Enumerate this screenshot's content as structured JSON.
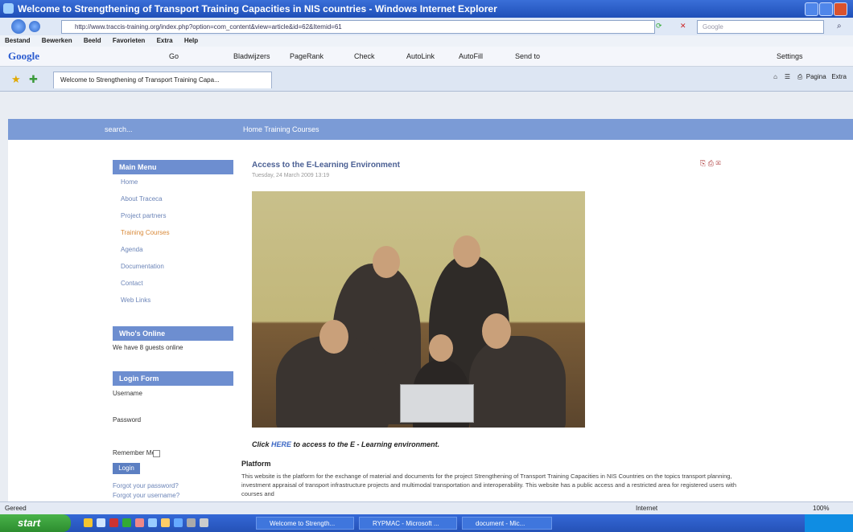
{
  "window": {
    "title": "Welcome to Strengthening of Transport Training Capacities in NIS countries - Windows Internet Explorer"
  },
  "address": {
    "url": "http://www.traccis-training.org/index.php?option=com_content&view=article&id=62&Itemid=61",
    "search_placeholder": "Google"
  },
  "menubar": {
    "items": [
      "Bestand",
      "Bewerken",
      "Beeld",
      "Favorieten",
      "Extra",
      "Help"
    ]
  },
  "google_toolbar": {
    "logo": "Google",
    "items": [
      "Go",
      "Bladwijzers",
      "PageRank",
      "Check",
      "AutoLink",
      "AutoFill",
      "Send to"
    ],
    "settings": "Settings"
  },
  "tabs": {
    "active_tab": "Welcome to Strengthening of Transport Training Capa..."
  },
  "commandbar": {
    "page": "Pagina",
    "extra": "Extra"
  },
  "site": {
    "search_label": "search...",
    "breadcrumb": "Home   Training Courses",
    "main_menu": {
      "header": "Main Menu",
      "items": [
        "Home",
        "About Traceca",
        "Project partners",
        "Training Courses",
        "Agenda",
        "Documentation",
        "Contact",
        "Web Links"
      ]
    },
    "whos_online": {
      "header": "Who's Online",
      "text": "We have 8 guests online"
    },
    "login": {
      "header": "Login Form",
      "username_label": "Username",
      "password_label": "Password",
      "remember_label": "Remember Me",
      "button": "Login",
      "forgot_password": "Forgot your password?",
      "forgot_username": "Forgot your username?"
    },
    "article": {
      "title": "Access to the E-Learning Environment",
      "date": "Tuesday, 24 March 2009 13:19",
      "tools_icons": [
        "pdf-icon",
        "print-icon",
        "email-icon"
      ],
      "click_before": "Click ",
      "click_link": "HERE",
      "click_after": " to access to the E - Learning environment.",
      "platform_heading": "Platform",
      "platform_text": "This website is the platform for the exchange of material and documents for the project Strengthening of Transport Training Capacities in NIS Countries on the topics transport planning, investment appraisal of transport infrastructure projects and multimodal transportation and interoperability. This website has a public access and a restricted area for registered users with courses and"
    }
  },
  "statusbar": {
    "left": "Gereed",
    "zone": "Internet",
    "zoom": "100%"
  },
  "taskbar": {
    "start": "start",
    "items": [
      "Welcome to Strength...",
      "RYPMAC - Microsoft ...",
      "document - Mic..."
    ]
  }
}
